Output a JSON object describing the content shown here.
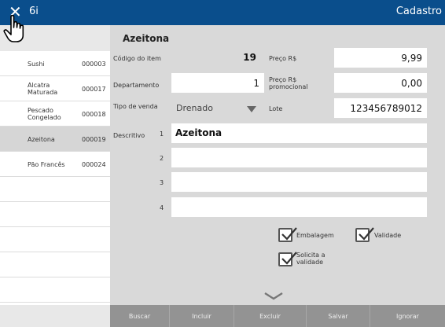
{
  "window": {
    "app_title": "6i",
    "screen_title": "Cadastro"
  },
  "list": {
    "items": [
      {
        "name": "Sushi",
        "code": "000003",
        "selected": false
      },
      {
        "name": "Alcatra Maturada",
        "code": "000017",
        "selected": false
      },
      {
        "name": "Pescado Congelado",
        "code": "000018",
        "selected": false
      },
      {
        "name": "Azeitona",
        "code": "000019",
        "selected": true
      },
      {
        "name": "Pão Francês",
        "code": "000024",
        "selected": false
      }
    ]
  },
  "form": {
    "product_title": "Azeitona",
    "codigo_label": "Código do item",
    "codigo_value": "19",
    "preco_label": "Preço R$",
    "preco_value": "9,99",
    "departamento_label": "Departamento",
    "departamento_value": "1",
    "preco_promo_label": "Preço R$ promocional",
    "preco_promo_value": "0,00",
    "tipo_venda_label": "Tipo de venda",
    "tipo_venda_value": "Drenado",
    "lote_label": "Lote",
    "lote_value": "123456789012",
    "descritivo_label": "Descritivo",
    "descritivo_lines": [
      {
        "num": "1",
        "value": "Azeitona"
      },
      {
        "num": "2",
        "value": ""
      },
      {
        "num": "3",
        "value": ""
      },
      {
        "num": "4",
        "value": ""
      }
    ],
    "checkboxes": {
      "embalagem": {
        "label": "Embalagem",
        "checked": true
      },
      "validade": {
        "label": "Validade",
        "checked": true
      },
      "solicita_validade": {
        "label": "Solicita a validade",
        "checked": true
      }
    }
  },
  "toolbar": {
    "buscar": "Buscar",
    "incluir": "Incluir",
    "excluir": "Excluir",
    "salvar": "Salvar",
    "ignorar": "Ignorar"
  },
  "icons": {
    "close": "close-icon",
    "cursor": "hand-pointer-icon",
    "dropdown": "caret-down-icon",
    "expand": "chevron-down-icon",
    "check": "checkmark-icon"
  },
  "colors": {
    "titlebar": "#0a4e8c",
    "form_bg": "#d9d9d9",
    "toolbar_bg": "#939393",
    "selected_row": "#d6d6d6"
  }
}
